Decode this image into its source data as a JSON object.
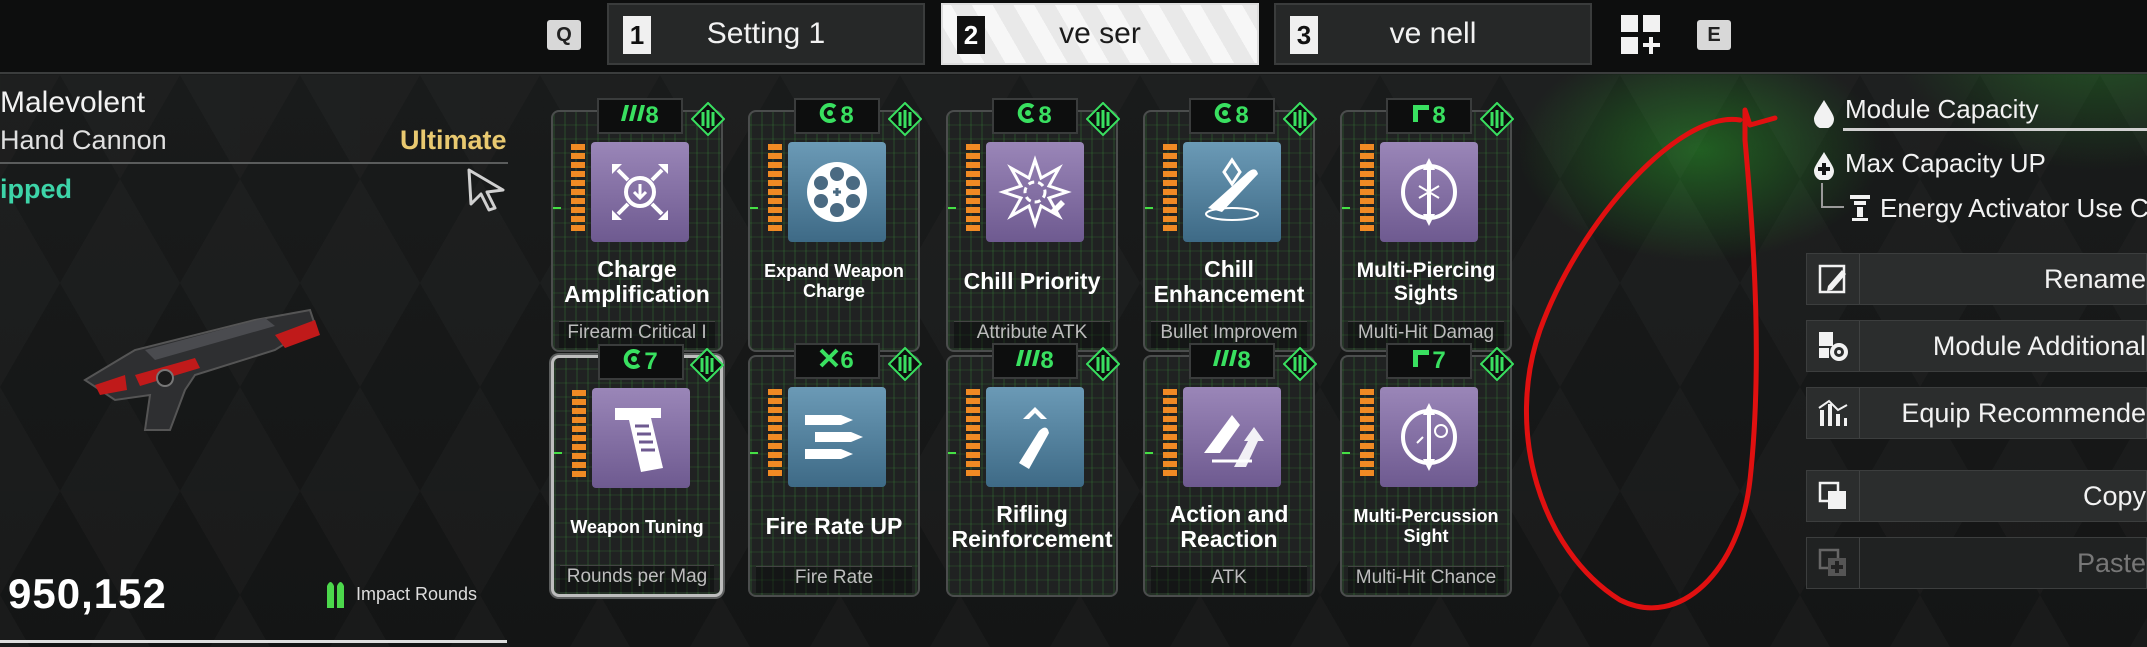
{
  "topbar": {
    "left_key": "Q",
    "right_key": "E",
    "tabs": [
      {
        "num": "1",
        "label": "Setting 1",
        "active": false
      },
      {
        "num": "2",
        "label": "ve ser",
        "active": true
      },
      {
        "num": "3",
        "label": "ve nell",
        "active": false
      }
    ],
    "add_setting_icon": "add-grid-icon"
  },
  "weapon": {
    "name": "Malevolent",
    "type": "Hand Cannon",
    "rarity": "Ultimate",
    "status": "ipped",
    "power": "950,152",
    "ammo_type": "Impact Rounds",
    "colors": {
      "rarity": "#e9c970",
      "status": "#3dd4a8"
    }
  },
  "modules": [
    {
      "cost": "8",
      "cost_icon": "triple-bar-icon",
      "name": "Charge Amplification",
      "sub": "Firearm Critical I",
      "icon": "charge-burst-icon",
      "bg": "purple",
      "size": "l",
      "selected": false
    },
    {
      "cost": "8",
      "cost_icon": "c-icon",
      "name": "Expand Weapon Charge",
      "sub": "",
      "icon": "revolver-cylinder-icon",
      "bg": "blue",
      "size": "s",
      "selected": false
    },
    {
      "cost": "8",
      "cost_icon": "c-icon",
      "name": "Chill Priority",
      "sub": "Attribute ATK",
      "icon": "chill-burst-icon",
      "bg": "purple",
      "size": "l",
      "selected": false
    },
    {
      "cost": "8",
      "cost_icon": "c-icon",
      "name": "Chill Enhancement",
      "sub": "Bullet Improvem",
      "icon": "frost-bullet-icon",
      "bg": "blue",
      "size": "l",
      "selected": false
    },
    {
      "cost": "8",
      "cost_icon": "r-icon",
      "name": "Multi-Piercing Sights",
      "sub": "Multi-Hit Damag",
      "icon": "pierce-sight-icon",
      "bg": "purple",
      "size": "m",
      "selected": false
    },
    {
      "cost": "7",
      "cost_icon": "c-icon",
      "name": "Weapon Tuning",
      "sub": "Rounds per Mag",
      "icon": "magazine-icon",
      "bg": "purple",
      "size": "s",
      "selected": true
    },
    {
      "cost": "6",
      "cost_icon": "x-icon",
      "name": "Fire Rate UP",
      "sub": "Fire Rate",
      "icon": "bullets-icon",
      "bg": "blue",
      "size": "l",
      "selected": false
    },
    {
      "cost": "8",
      "cost_icon": "triple-bar-icon",
      "name": "Rifling Reinforcement",
      "sub": "",
      "icon": "bullet-chevron-icon",
      "bg": "blue",
      "size": "l",
      "selected": false
    },
    {
      "cost": "8",
      "cost_icon": "triple-bar-icon",
      "name": "Action and Reaction",
      "sub": "ATK",
      "icon": "recoil-arrows-icon",
      "bg": "purple",
      "size": "l",
      "selected": false
    },
    {
      "cost": "7",
      "cost_icon": "r-icon",
      "name": "Multi-Percussion Sight",
      "sub": "Multi-Hit Chance",
      "icon": "percussion-sight-icon",
      "bg": "purple",
      "size": "s",
      "selected": false
    }
  ],
  "right_panel": {
    "capacity_title": "Module Capacity",
    "max_cap": "Max Capacity UP",
    "activator": "Energy Activator Use C",
    "buttons": [
      {
        "label": "Rename",
        "icon": "edit-icon",
        "disabled": false
      },
      {
        "label": "Module Additional",
        "icon": "module-settings-icon",
        "disabled": false
      },
      {
        "label": "Equip Recommende",
        "icon": "chart-icon",
        "disabled": false
      },
      {
        "label": "Copy",
        "icon": "copy-icon",
        "disabled": false
      },
      {
        "label": "Paste",
        "icon": "paste-icon",
        "disabled": true
      }
    ]
  },
  "colors": {
    "accent_green": "#39e060",
    "annotation_red": "#e01010"
  }
}
